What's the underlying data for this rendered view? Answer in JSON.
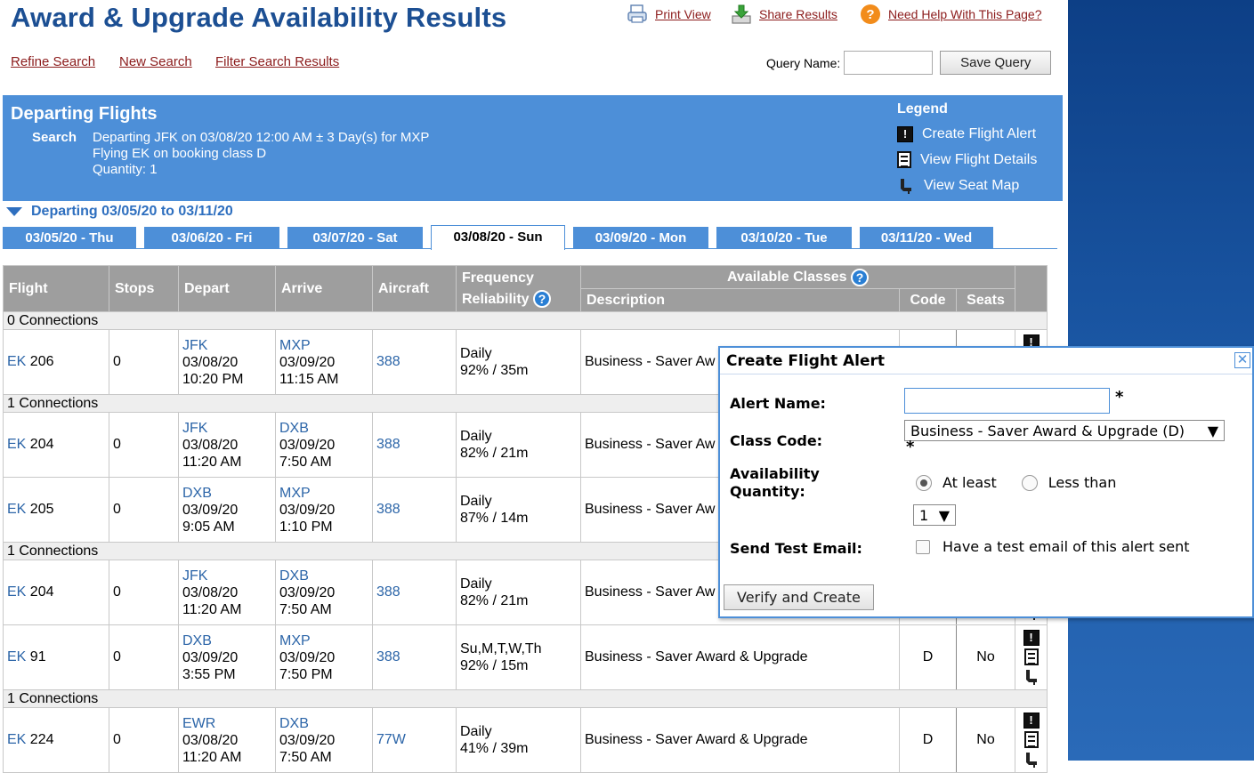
{
  "header": {
    "title": "Award & Upgrade Availability Results",
    "print_view": "Print View",
    "share_results": "Share Results",
    "need_help": "Need Help With This Page?",
    "refine_search": "Refine Search",
    "new_search": "New Search",
    "filter_results": "Filter Search Results",
    "query_name_label": "Query Name:",
    "query_name_value": "",
    "save_query": "Save Query"
  },
  "departing": {
    "title": "Departing Flights",
    "search_label": "Search",
    "search_lines": [
      "Departing JFK on 03/08/20 12:00 AM ± 3 Day(s) for MXP",
      "Flying EK on booking class D",
      "Quantity: 1"
    ],
    "legend_title": "Legend",
    "legend": [
      "Create Flight Alert",
      "View Flight Details",
      "View Seat Map"
    ],
    "range_title": "Departing 03/05/20 to 03/11/20",
    "tabs": [
      "03/05/20 - Thu",
      "03/06/20 - Fri",
      "03/07/20 - Sat",
      "03/08/20 - Sun",
      "03/09/20 - Mon",
      "03/10/20 - Tue",
      "03/11/20 - Wed"
    ],
    "active_tab": 3
  },
  "table": {
    "headers": {
      "flight": "Flight",
      "stops": "Stops",
      "depart": "Depart",
      "arrive": "Arrive",
      "aircraft": "Aircraft",
      "frequency": "Frequency",
      "reliability": "Reliability",
      "available_classes": "Available Classes",
      "description": "Description",
      "code": "Code",
      "seats": "Seats"
    },
    "groups": [
      {
        "label": "0 Connections",
        "rows": [
          {
            "airline": "EK",
            "number": "206",
            "stops": "0",
            "dep_airport": "JFK",
            "dep_date": "03/08/20",
            "dep_time": "10:20 PM",
            "arr_airport": "MXP",
            "arr_date": "03/09/20",
            "arr_time": "11:15 AM",
            "aircraft": "388",
            "frequency": "Daily",
            "reliability": "92% / 35m",
            "description": "Business - Saver Aw",
            "code": "",
            "seats": ""
          }
        ]
      },
      {
        "label": "1 Connections",
        "rows": [
          {
            "airline": "EK",
            "number": "204",
            "stops": "0",
            "dep_airport": "JFK",
            "dep_date": "03/08/20",
            "dep_time": "11:20 AM",
            "arr_airport": "DXB",
            "arr_date": "03/09/20",
            "arr_time": "7:50 AM",
            "aircraft": "388",
            "frequency": "Daily",
            "reliability": "82% / 21m",
            "description": "Business - Saver Aw",
            "code": "",
            "seats": ""
          },
          {
            "airline": "EK",
            "number": "205",
            "stops": "0",
            "dep_airport": "DXB",
            "dep_date": "03/09/20",
            "dep_time": "9:05 AM",
            "arr_airport": "MXP",
            "arr_date": "03/09/20",
            "arr_time": "1:10 PM",
            "aircraft": "388",
            "frequency": "Daily",
            "reliability": "87% / 14m",
            "description": "Business - Saver Aw",
            "code": "",
            "seats": ""
          }
        ]
      },
      {
        "label": "1 Connections",
        "rows": [
          {
            "airline": "EK",
            "number": "204",
            "stops": "0",
            "dep_airport": "JFK",
            "dep_date": "03/08/20",
            "dep_time": "11:20 AM",
            "arr_airport": "DXB",
            "arr_date": "03/09/20",
            "arr_time": "7:50 AM",
            "aircraft": "388",
            "frequency": "Daily",
            "reliability": "82% / 21m",
            "description": "Business - Saver Aw",
            "code": "",
            "seats": ""
          },
          {
            "airline": "EK",
            "number": "91",
            "stops": "0",
            "dep_airport": "DXB",
            "dep_date": "03/09/20",
            "dep_time": "3:55 PM",
            "arr_airport": "MXP",
            "arr_date": "03/09/20",
            "arr_time": "7:50 PM",
            "aircraft": "388",
            "frequency": "Su,M,T,W,Th",
            "reliability": "92% / 15m",
            "description": "Business - Saver Award & Upgrade",
            "code": "D",
            "seats": "No"
          }
        ]
      },
      {
        "label": "1 Connections",
        "rows": [
          {
            "airline": "EK",
            "number": "224",
            "stops": "0",
            "dep_airport": "EWR",
            "dep_date": "03/08/20",
            "dep_time": "11:20 AM",
            "arr_airport": "DXB",
            "arr_date": "03/09/20",
            "arr_time": "7:50 AM",
            "aircraft": "77W",
            "frequency": "Daily",
            "reliability": "41% / 39m",
            "description": "Business - Saver Award & Upgrade",
            "code": "D",
            "seats": "No"
          }
        ]
      }
    ]
  },
  "alert_dialog": {
    "title": "Create Flight Alert",
    "alert_name_label": "Alert Name:",
    "alert_name_value": "",
    "required_mark": "*",
    "class_code_label": "Class Code:",
    "class_code_value": "Business - Saver Award & Upgrade (D)",
    "availability_label_1": "Availability",
    "availability_label_2": "Quantity:",
    "at_least": "At least",
    "less_than": "Less than",
    "quantity_value": "1",
    "send_test_label": "Send Test Email:",
    "send_test_text": "Have a test email of this alert sent",
    "submit": "Verify and Create",
    "close_glyph": "✕"
  },
  "icons": {
    "print": "print-icon",
    "share": "download-icon",
    "help": "help-icon",
    "alert": "exclamation-icon",
    "details": "document-icon",
    "seat": "seat-icon",
    "question": "question-icon"
  },
  "colors": {
    "title_blue": "#1c4f93",
    "panel_blue": "#4d8fd8",
    "link_red": "#8c1c1c",
    "table_header_gray": "#9e9e9e",
    "help_orange": "#f28c1b"
  }
}
